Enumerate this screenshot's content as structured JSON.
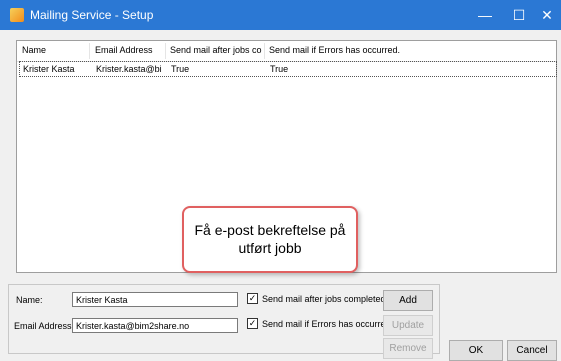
{
  "window": {
    "title": "Mailing Service - Setup"
  },
  "titlebar_controls": {
    "minimize": "—",
    "maximize": "☐",
    "close": "✕"
  },
  "list": {
    "columns": [
      "Name",
      "Email Address",
      "Send mail after jobs co...",
      "Send mail if Errors has occurred."
    ],
    "rows": [
      {
        "name": "Krister Kasta",
        "email": "Krister.kasta@bi...",
        "after_jobs": "True",
        "on_errors": "True"
      }
    ]
  },
  "callout": {
    "text": "Få e-post bekreftelse på utført jobb"
  },
  "form": {
    "name_label": "Name:",
    "name_value": "Krister Kasta",
    "email_label": "Email Address:",
    "email_value": "Krister.kasta@bim2share.no",
    "check_after_jobs_label": "Send mail after jobs completed.",
    "check_errors_label": "Send mail if Errors has occurred.",
    "add_label": "Add",
    "update_label": "Update",
    "remove_label": "Remove"
  },
  "dialog_buttons": {
    "ok_label": "OK",
    "cancel_label": "Cancel"
  }
}
